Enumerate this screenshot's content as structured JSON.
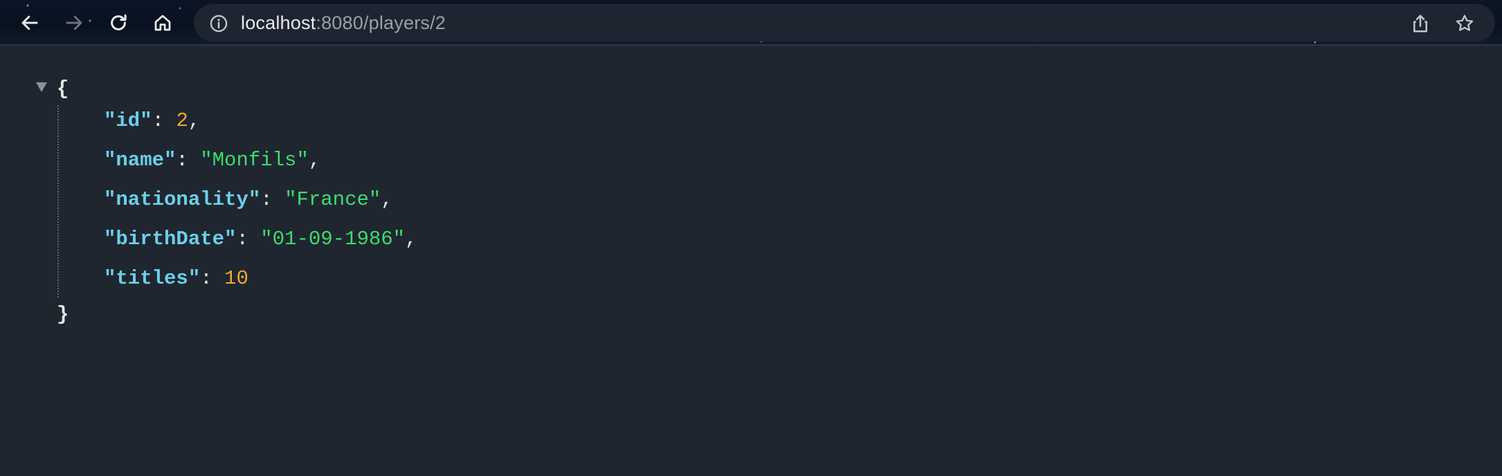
{
  "browser": {
    "url_host": "localhost",
    "url_rest": ":8080/players/2",
    "icons": {
      "back": "arrow-left-icon",
      "forward": "arrow-right-icon",
      "reload": "reload-icon",
      "home": "home-icon",
      "site_info": "info-icon",
      "share": "share-icon",
      "bookmark": "star-icon"
    }
  },
  "json_view": {
    "open_brace": "{",
    "close_brace": "}",
    "rows": [
      {
        "key": "\"id\"",
        "value": "2",
        "trail": ",",
        "value_type": "number"
      },
      {
        "key": "\"name\"",
        "value": "\"Monfils\"",
        "trail": ",",
        "value_type": "string"
      },
      {
        "key": "\"nationality\"",
        "value": "\"France\"",
        "trail": ",",
        "value_type": "string"
      },
      {
        "key": "\"birthDate\"",
        "value": "\"01-09-1986\"",
        "trail": ",",
        "value_type": "string"
      },
      {
        "key": "\"titles\"",
        "value": "10",
        "trail": "",
        "value_type": "number"
      }
    ]
  },
  "colors": {
    "background": "#1f2630",
    "key": "#6ad0e8",
    "string": "#3ddc6e",
    "number": "#f0a830"
  }
}
